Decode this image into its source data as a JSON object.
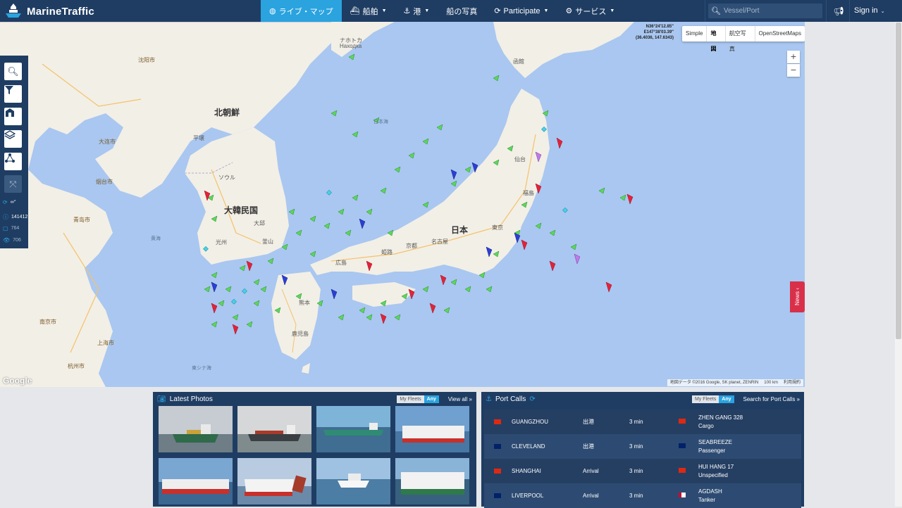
{
  "brand": {
    "name": "MarineTraffic"
  },
  "nav": {
    "items": [
      {
        "label": "ライブ・マップ",
        "icon": "globe-icon",
        "caret": false,
        "active": true
      },
      {
        "label": "船舶",
        "icon": "ship-icon",
        "caret": true,
        "active": false
      },
      {
        "label": "港",
        "icon": "anchor-icon",
        "caret": true,
        "active": false
      },
      {
        "label": "船の写真",
        "icon": "",
        "caret": false,
        "active": false
      },
      {
        "label": "Participate",
        "icon": "refresh-icon",
        "caret": true,
        "active": false
      },
      {
        "label": "サービス",
        "icon": "gear-icon",
        "caret": true,
        "active": false
      }
    ],
    "search_placeholder": "Vessel/Port",
    "signin": "Sign in"
  },
  "map": {
    "coords": {
      "lat": "N36°24'12.85\"",
      "lon": "E147°38'03.39\"",
      "decimal": "(36.4036, 147.6343)"
    },
    "map_types": [
      "Simple",
      "地図",
      "航空写真",
      "OpenStreetMaps"
    ],
    "selected_map_type": "地図",
    "zoom_in": "+",
    "zoom_out": "−",
    "attribution": "地図データ ©2016 Google, SK planet, ZENRIN",
    "scale": "100 km",
    "terms": "利用規約",
    "google": "Google",
    "news_tab": "News",
    "stats": {
      "infinity": "∞°",
      "vessels": "141412",
      "count2": "764",
      "count3": "706"
    },
    "labels": [
      {
        "text": "北朝鮮",
        "cls": "big"
      },
      {
        "text": "大韓民国",
        "cls": "big"
      },
      {
        "text": "日本",
        "cls": "big"
      },
      {
        "text": "日本海",
        "cls": "sea"
      },
      {
        "text": "黄海",
        "cls": "sea"
      },
      {
        "text": "東シナ海",
        "cls": "sea"
      },
      {
        "text": "ソウル",
        "cls": ""
      },
      {
        "text": "平壌",
        "cls": ""
      },
      {
        "text": "大邱",
        "cls": ""
      },
      {
        "text": "光州",
        "cls": ""
      },
      {
        "text": "釜山",
        "cls": ""
      },
      {
        "text": "仙台",
        "cls": ""
      },
      {
        "text": "東京",
        "cls": ""
      },
      {
        "text": "名古屋",
        "cls": ""
      },
      {
        "text": "京都",
        "cls": ""
      },
      {
        "text": "姫路",
        "cls": ""
      },
      {
        "text": "広島",
        "cls": ""
      },
      {
        "text": "熊本",
        "cls": ""
      },
      {
        "text": "鹿児島",
        "cls": ""
      },
      {
        "text": "函館",
        "cls": ""
      },
      {
        "text": "ナホトカ",
        "cls": ""
      },
      {
        "text": "Находка",
        "cls": ""
      },
      {
        "text": "沈阳市",
        "cls": "orange"
      },
      {
        "text": "大连市",
        "cls": "orange"
      },
      {
        "text": "青岛市",
        "cls": "orange"
      },
      {
        "text": "烟台市",
        "cls": "orange"
      },
      {
        "text": "上海市",
        "cls": "orange"
      },
      {
        "text": "南京市",
        "cls": "orange"
      },
      {
        "text": "杭州市",
        "cls": "orange"
      },
      {
        "text": "福島",
        "cls": ""
      }
    ]
  },
  "photos_panel": {
    "title": "Latest Photos",
    "toggle": [
      "My Fleets",
      "Any"
    ],
    "link": "View all »"
  },
  "port_calls_panel": {
    "title": "Port Calls",
    "toggle": [
      "My Fleets",
      "Any"
    ],
    "link": "Search for Port Calls »",
    "rows": [
      {
        "port": "GUANGZHOU",
        "type": "出港",
        "time": "3 min",
        "vessel": "ZHEN GANG 328",
        "vessel_type": "Cargo",
        "flag1": "#de2910",
        "flag2": "#de2910"
      },
      {
        "port": "CLEVELAND",
        "type": "出港",
        "time": "3 min",
        "vessel": "SEABREEZE",
        "vessel_type": "Passenger",
        "flag1": "#012169",
        "flag2": "#012169"
      },
      {
        "port": "SHANGHAI",
        "type": "Arrival",
        "time": "3 min",
        "vessel": "HUI HANG 17",
        "vessel_type": "Unspecified",
        "flag1": "#de2910",
        "flag2": "#de2910"
      },
      {
        "port": "LIVERPOOL",
        "type": "Arrival",
        "time": "3 min",
        "vessel": "AGDASH",
        "vessel_type": "Tanker",
        "flag1": "#012169",
        "flag2": "#c60c30"
      }
    ]
  }
}
